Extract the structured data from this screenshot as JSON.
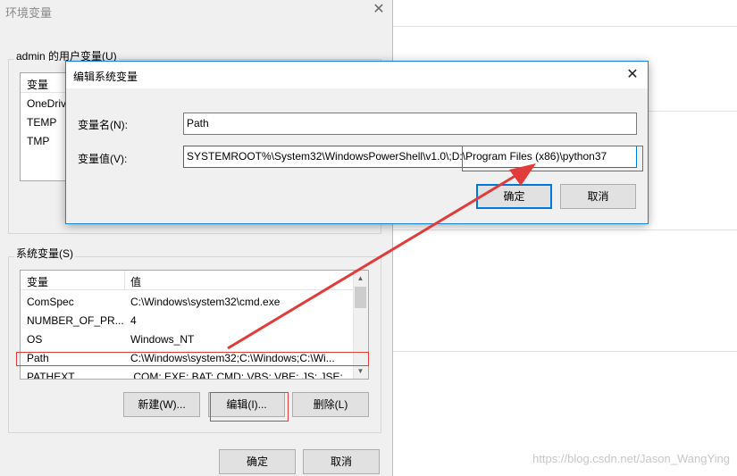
{
  "env_dialog": {
    "title": "环境变量",
    "close_glyph": "✕",
    "user_vars": {
      "label": "admin 的用户变量(U)",
      "columns": [
        "变量",
        ""
      ],
      "rows": [
        {
          "name": "OneDrive",
          "value": ""
        },
        {
          "name": "TEMP",
          "value": ""
        },
        {
          "name": "TMP",
          "value": ""
        }
      ]
    },
    "system_vars": {
      "label": "系统变量(S)",
      "columns": [
        "变量",
        "值"
      ],
      "rows": [
        {
          "name": "ComSpec",
          "value": "C:\\Windows\\system32\\cmd.exe"
        },
        {
          "name": "NUMBER_OF_PR...",
          "value": "4"
        },
        {
          "name": "OS",
          "value": "Windows_NT"
        },
        {
          "name": "Path",
          "value": "C:\\Windows\\system32;C:\\Windows;C:\\Wi..."
        },
        {
          "name": "PATHEXT",
          "value": ".COM;.EXE;.BAT;.CMD;.VBS;.VBE;.JS;.JSE;..."
        }
      ]
    },
    "buttons": {
      "new": "新建(W)...",
      "edit": "编辑(I)...",
      "delete": "删除(L)",
      "ok": "确定",
      "cancel": "取消"
    }
  },
  "edit_dialog": {
    "title": "编辑系统变量",
    "close_glyph": "✕",
    "name_label": "变量名(N):",
    "name_value": "Path",
    "value_label": "变量值(V):",
    "value_value": "SYSTEMROOT%\\System32\\WindowsPowerShell\\v1.0\\;D:\\Program Files (x86)\\python37",
    "ok": "确定",
    "cancel": "取消"
  },
  "watermark": "https://blog.csdn.net/Jason_WangYing",
  "colors": {
    "accent": "#0078d7",
    "annotation_red": "#e23b3b"
  }
}
